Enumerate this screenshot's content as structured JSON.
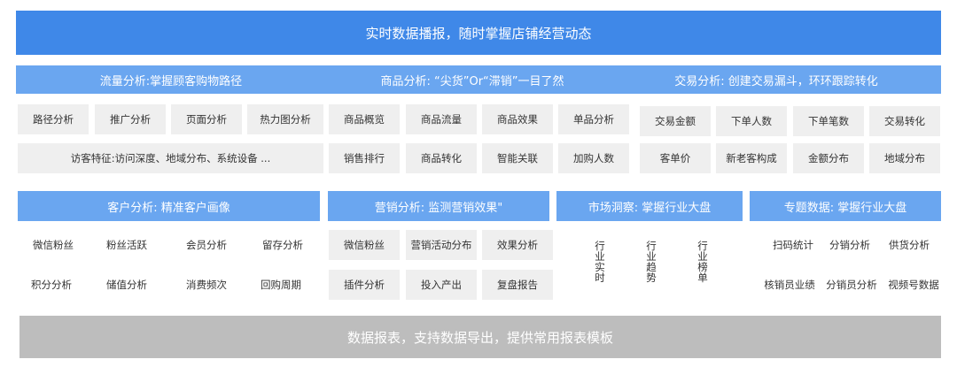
{
  "top_banner": "实时数据播报，随时掌握店铺经营动态",
  "row1_headers": {
    "traffic": "流量分析:掌握顾客购物路径",
    "product": "商品分析: “尖货”Or“滞销”一目了然",
    "trade": "交易分析: 创建交易漏斗，环环跟踪转化"
  },
  "traffic_items": [
    "路径分析",
    "推广分析",
    "页面分析",
    "热力图分析"
  ],
  "traffic_wide": "访客特征:访问深度、地域分布、系统设备 ...",
  "product_row1": [
    "商品概览",
    "商品流量",
    "商品效果",
    "单品分析"
  ],
  "product_row2": [
    "销售排行",
    "商品转化",
    "智能关联",
    "加购人数"
  ],
  "trade_row1": [
    "交易金额",
    "下单人数",
    "下单笔数",
    "交易转化"
  ],
  "trade_row2": [
    "客单价",
    "新老客构成",
    "金额分布",
    "地域分布"
  ],
  "row2_headers": {
    "customer": "客户分析: 精准客户画像",
    "marketing": "营销分析: 监测营销效果\"",
    "market": "市场洞察: 掌握行业大盘",
    "topic": "专题数据: 掌握行业大盘"
  },
  "customer_row1": [
    "微信粉丝",
    "粉丝活跃",
    "会员分析",
    "留存分析"
  ],
  "customer_row2": [
    "积分分析",
    "储值分析",
    "消费频次",
    "回购周期"
  ],
  "marketing_row1": [
    "微信粉丝",
    "营销活动分布",
    "效果分析"
  ],
  "marketing_row2": [
    "插件分析",
    "投入产出",
    "复盘报告"
  ],
  "market_items": [
    "行业实时",
    "行业趋势",
    "行业榜单"
  ],
  "topic_row1": [
    "扫码统计",
    "分销分析",
    "供货分析"
  ],
  "topic_row2": [
    "核销员业绩",
    "分销员分析",
    "视频号数据"
  ],
  "bottom_banner": "数据报表，支持数据导出，提供常用报表模板",
  "colors": {
    "top_banner": "#3f88e8",
    "header": "#6aa6f0",
    "cell": "#efefef",
    "bottom_banner": "#bdbdbd"
  }
}
